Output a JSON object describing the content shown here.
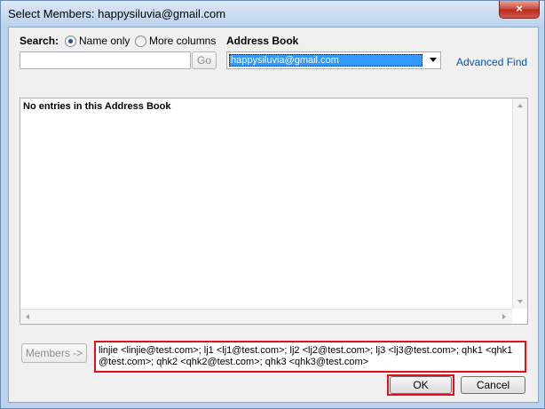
{
  "window": {
    "title": "Select Members: happysiluvia@gmail.com",
    "close_glyph": "×"
  },
  "search": {
    "label": "Search:",
    "options": [
      {
        "label": "Name only",
        "checked": true
      },
      {
        "label": "More columns",
        "checked": false
      }
    ],
    "input_value": "",
    "go_label": "Go"
  },
  "address_book": {
    "label": "Address Book",
    "selected": "happysiluvia@gmail.com",
    "advanced_find_label": "Advanced Find"
  },
  "entries": {
    "empty_message": "No entries in this Address Book"
  },
  "members": {
    "button_label": "Members ->",
    "value": "linjie <linjie@test.com>; lj1 <lj1@test.com>; lj2 <lj2@test.com>; lj3 <lj3@test.com>; qhk1 <qhk1@test.com>; qhk2 <qhk2@test.com>; qhk3 <qhk3@test.com>"
  },
  "footer": {
    "ok_label": "OK",
    "cancel_label": "Cancel"
  },
  "colors": {
    "highlight": "#e0101c",
    "selection": "#3399ff",
    "link": "#0a4fa3"
  }
}
